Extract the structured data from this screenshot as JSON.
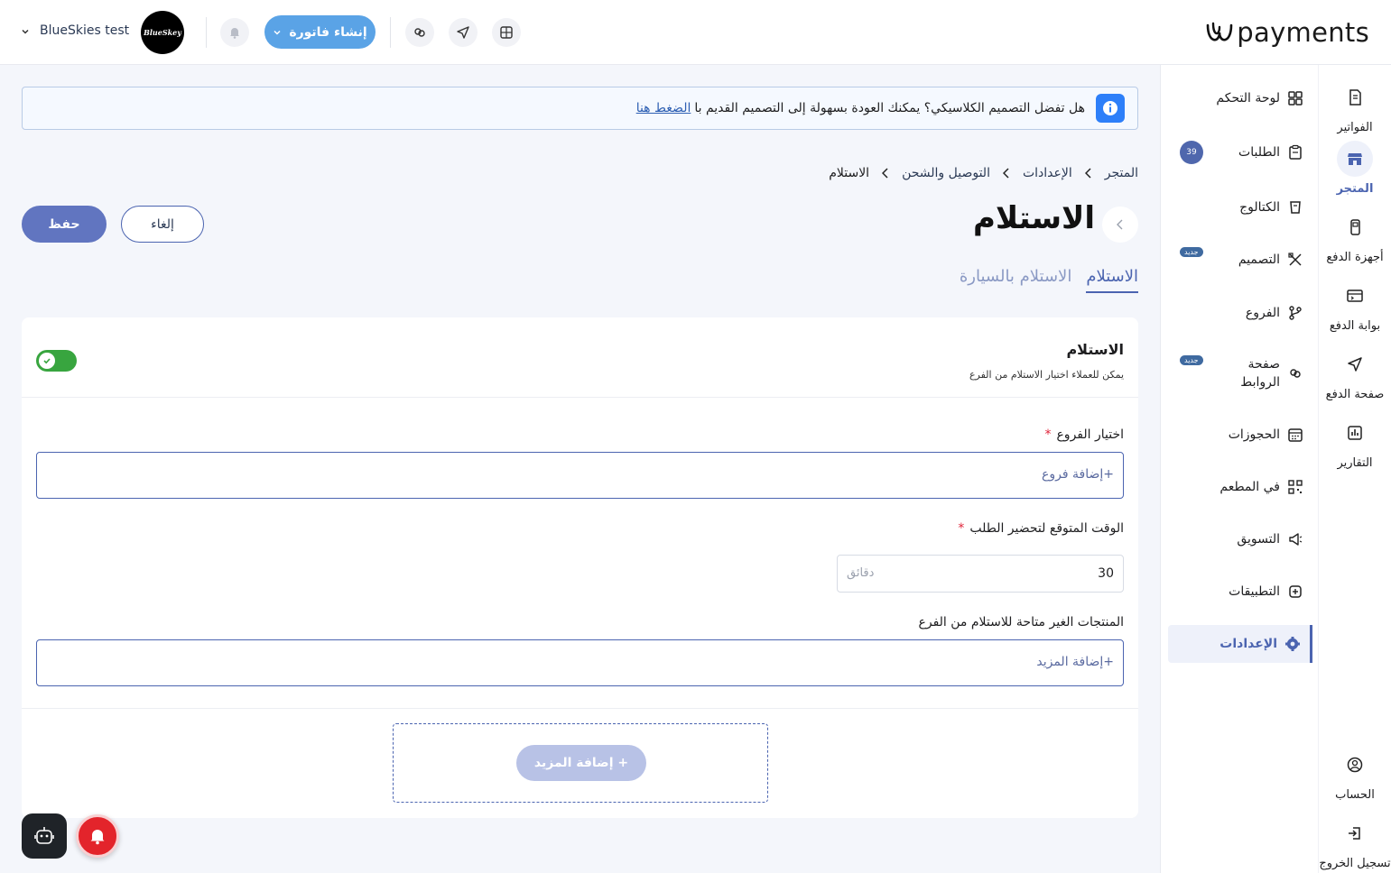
{
  "brand": {
    "logo_text": "payments"
  },
  "header": {
    "invoice_button": "إنشاء فاتورة",
    "account_name": "BlueSkies testi...",
    "avatar_text": "BlueSkey"
  },
  "rail": {
    "items": [
      {
        "label": "الفواتير",
        "icon": "invoice-icon"
      },
      {
        "label": "المتجر",
        "icon": "store-icon",
        "active": true
      },
      {
        "label": "أجهزة الدفع",
        "icon": "pos-device-icon"
      },
      {
        "label": "بوابة الدفع",
        "icon": "payment-gateway-icon"
      },
      {
        "label": "صفحة الدفع",
        "icon": "send-icon"
      },
      {
        "label": "التقارير",
        "icon": "reports-icon"
      }
    ],
    "bottom": [
      {
        "label": "الحساب",
        "icon": "account-icon"
      },
      {
        "label": "تسجيل الخروج",
        "icon": "logout-icon"
      }
    ]
  },
  "subnav": {
    "items": [
      {
        "label": "لوحة التحكم",
        "icon": "dashboard-icon"
      },
      {
        "label": "الطلبات",
        "icon": "orders-icon",
        "badge": "39"
      },
      {
        "label": "الكتالوج",
        "icon": "catalog-icon"
      },
      {
        "label": "التصميم",
        "icon": "design-icon",
        "new": "جديد"
      },
      {
        "label": "الفروع",
        "icon": "branches-icon"
      },
      {
        "label": "صفحة الروابط",
        "icon": "links-icon",
        "new": "جديد"
      },
      {
        "label": "الحجوزات",
        "icon": "calendar-icon"
      },
      {
        "label": "في المطعم",
        "icon": "qr-icon"
      },
      {
        "label": "التسويق",
        "icon": "megaphone-icon"
      },
      {
        "label": "التطبيقات",
        "icon": "apps-icon"
      },
      {
        "label": "الإعدادات",
        "icon": "gear-icon",
        "active": true
      }
    ]
  },
  "banner": {
    "text": "هل تفضل التصميم الكلاسيكي؟ يمكنك العودة بسهولة إلى التصميم القديم با",
    "link": "الضغط هنا"
  },
  "breadcrumb": [
    "المتجر",
    "الإعدادات",
    "التوصيل والشحن",
    "الاستلام"
  ],
  "page": {
    "title": "الاستلام",
    "cancel": "إلغاء",
    "save": "حفظ",
    "tabs": [
      {
        "label": "الاستلام",
        "active": true
      },
      {
        "label": "الاستلام بالسيارة",
        "active": false
      }
    ]
  },
  "card": {
    "title": "الاستلام",
    "subtitle": "يمكن للعملاء اختيار الاستلام من الفرع",
    "toggle_on": true,
    "branches_label": "اختيار الفروع",
    "branches_placeholder": "+إضافة فروع",
    "prep_label": "الوقت المتوقع لتحضير الطلب",
    "prep_value": "30",
    "prep_unit": "دقائق",
    "unavailable_label": "المنتجات الغير متاحة للاستلام من الفرع",
    "unavailable_placeholder": "+إضافة المزيد",
    "add_more_button": "+ إضافة المزيد",
    "required_mark": "*"
  },
  "colors": {
    "accent": "#4b64b0",
    "toggle": "#38a53f",
    "invoice_btn": "#5aa3e6"
  }
}
